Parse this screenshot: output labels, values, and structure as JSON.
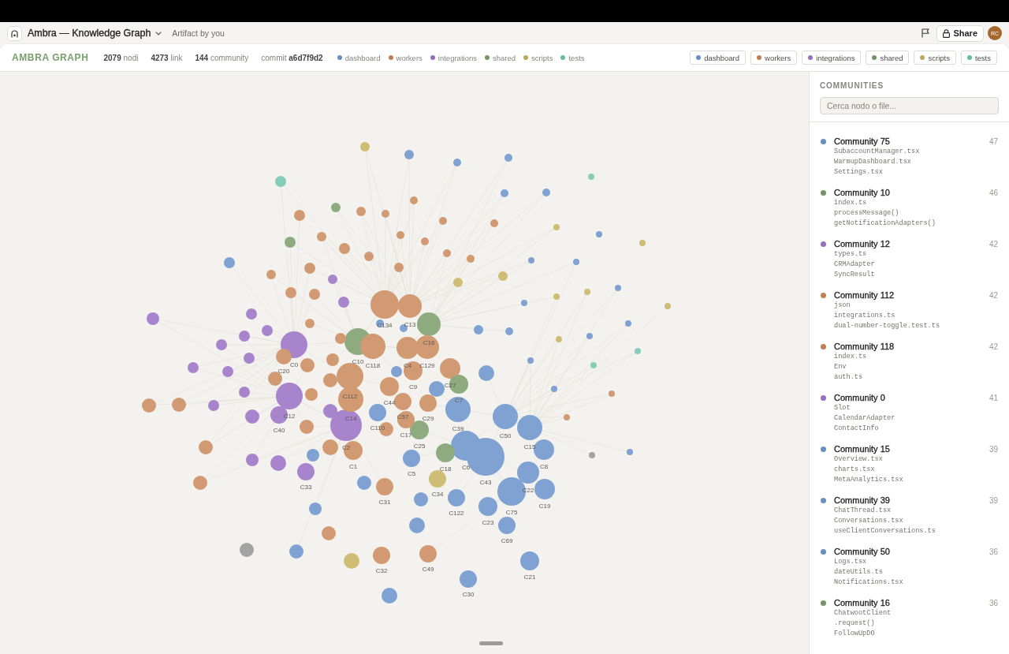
{
  "window": {
    "title": "Ambra — Knowledge Graph",
    "subtitle": "Artifact by you",
    "share_button": "Share",
    "avatar": "RC"
  },
  "toolbar": {
    "brand": "AMBRA GRAPH",
    "stats": [
      "**2079** nodi",
      "**4273** link",
      "**144** community",
      "commit **a6d7f9d2**"
    ],
    "legend": [
      {
        "label": "dashboard",
        "color": "#6a8ec4"
      },
      {
        "label": "workers",
        "color": "#c27f52"
      },
      {
        "label": "integrations",
        "color": "#9670bd"
      },
      {
        "label": "shared",
        "color": "#76946a"
      },
      {
        "label": "scripts",
        "color": "#c0a75a"
      },
      {
        "label": "tests",
        "color": "#6bb9a3"
      }
    ],
    "filters": [
      {
        "label": "dashboard",
        "color": "#6a8ec4"
      },
      {
        "label": "workers",
        "color": "#c27f52"
      },
      {
        "label": "integrations",
        "color": "#9670bd"
      },
      {
        "label": "shared",
        "color": "#76946a"
      },
      {
        "label": "scripts",
        "color": "#c0a75a"
      },
      {
        "label": "tests",
        "color": "#6bb9a3"
      }
    ]
  },
  "graph": {
    "nodes": [
      {
        "color": "#cfbd76"
      },
      {
        "color": "#7fa2d2"
      },
      {
        "color": "#7fa2d2"
      },
      {
        "color": "#7fa2d2"
      },
      {
        "color": "#85ccb9"
      },
      {
        "color": "#85ccb9"
      },
      {
        "color": "#d19a72"
      },
      {
        "color": "#8dab7f"
      },
      {
        "color": "#d19a72"
      },
      {
        "color": "#d19a72"
      },
      {
        "color": "#d19a72"
      },
      {
        "color": "#7fa2d2"
      },
      {
        "color": "#7fa2d2"
      },
      {
        "color": "#d19a72"
      },
      {
        "color": "#d19a72"
      },
      {
        "color": "#cfbd76"
      },
      {
        "color": "#7fa2d2"
      },
      {
        "color": "#cfbd76"
      },
      {
        "color": "#d19a72"
      },
      {
        "color": "#d19a72"
      },
      {
        "color": "#8dab7f"
      },
      {
        "color": "#d19a72"
      },
      {
        "color": "#d19a72"
      },
      {
        "color": "#d19a72"
      },
      {
        "color": "#d19a72"
      },
      {
        "color": "#7fa2d2"
      },
      {
        "color": "#d19a72"
      },
      {
        "color": "#7fa2d2"
      },
      {
        "color": "#7fa2d2"
      },
      {
        "color": "#d19a72"
      },
      {
        "color": "#d19a72"
      },
      {
        "color": "#d19a72"
      },
      {
        "color": "#a884cc"
      },
      {
        "color": "#cfbd76"
      },
      {
        "color": "#cfbd76"
      },
      {
        "color": "#d19a72"
      },
      {
        "color": "#d19a72"
      },
      {
        "color": "#a884cc"
      },
      {
        "color": "#cfbd76"
      },
      {
        "color": "#cfbd76"
      },
      {
        "color": "#7fa2d2"
      },
      {
        "color": "#7fa2d2"
      },
      {
        "color": "#cfbd76"
      },
      {
        "color": "#a884cc"
      },
      {
        "color": "#a884cc"
      },
      {
        "color": "#d19a72"
      },
      {
        "color": "#a884cc"
      },
      {
        "color": "#a884cc"
      },
      {
        "color": "#a884cc"
      },
      {
        "color": "#a884cc"
      },
      {
        "color": "#a884cc"
      },
      {
        "color": "#a884cc"
      },
      {
        "color": "#a884cc"
      },
      {
        "color": "#a884cc"
      },
      {
        "color": "#a884cc"
      },
      {
        "color": "#d19a72"
      },
      {
        "color": "#d19a72"
      },
      {
        "color": "#d19a72"
      },
      {
        "color": "#d19a72"
      },
      {
        "color": "#a884cc"
      },
      {
        "color": "#a884cc"
      },
      {
        "color": "#d19a72"
      },
      {
        "color": "#d19a72"
      },
      {
        "color": "#d19a72"
      },
      {
        "color": "#d19a72"
      },
      {
        "color": "#d19a72"
      },
      {
        "color": "#d19a72"
      },
      {
        "color": "#a884cc"
      },
      {
        "color": "#d19a72"
      },
      {
        "color": "#d19a72"
      },
      {
        "color": "#7fa2d2"
      },
      {
        "color": "#7fa2d2"
      },
      {
        "color": "#7fa2d2"
      },
      {
        "color": "#7fa2d2"
      },
      {
        "color": "#d19a72"
      },
      {
        "color": "#7fa2d2"
      },
      {
        "color": "#7fa2d2"
      },
      {
        "color": "#7fa2d2"
      },
      {
        "color": "#7fa2d2"
      },
      {
        "color": "#7fa2d2"
      },
      {
        "color": "#d19a72"
      },
      {
        "color": "#7fa2d2"
      },
      {
        "color": "#7fa2d2"
      },
      {
        "color": "#7fa2d2"
      },
      {
        "color": "#cfbd76"
      },
      {
        "color": "#7fa2d2"
      },
      {
        "color": "#7fa2d2"
      },
      {
        "color": "#d19a72"
      },
      {
        "color": "#a3a3a3"
      },
      {
        "color": "#7fa2d2"
      },
      {
        "color": "#7fa2d2"
      },
      {
        "color": "#cfbd76"
      },
      {
        "color": "#7fa2d2"
      },
      {
        "color": "#85ccb9"
      },
      {
        "color": "#85ccb9"
      },
      {
        "color": "#7fa2d2"
      },
      {
        "color": "#d19a72"
      },
      {
        "color": "#a3a3a3"
      },
      {
        "color": "#7fa2d2"
      },
      {
        "label": "C134",
        "color": "#d19a72"
      },
      {
        "label": "C13",
        "color": "#d19a72"
      },
      {
        "label": "C16",
        "color": "#8dab7f"
      },
      {
        "label": "C20",
        "color": "#d19a72"
      },
      {
        "label": "C0",
        "color": "#a884cc"
      },
      {
        "label": "C10",
        "color": "#8dab7f"
      },
      {
        "label": "C118",
        "color": "#d19a72"
      },
      {
        "label": "C4",
        "color": "#d19a72"
      },
      {
        "label": "C129",
        "color": "#d19a72"
      },
      {
        "label": "C9",
        "color": "#d19a72"
      },
      {
        "label": "C27",
        "color": "#d19a72"
      },
      {
        "label": "C112",
        "color": "#d19a72"
      },
      {
        "label": "C44",
        "color": "#d19a72"
      },
      {
        "label": "C7",
        "color": "#8dab7f"
      },
      {
        "label": "C12",
        "color": "#a884cc"
      },
      {
        "label": "C14",
        "color": "#d19a72"
      },
      {
        "label": "C57",
        "color": "#d19a72"
      },
      {
        "label": "C29",
        "color": "#d19a72"
      },
      {
        "label": "C40",
        "color": "#a884cc"
      },
      {
        "label": "C110",
        "color": "#7fa2d2"
      },
      {
        "label": "C17",
        "color": "#d19a72"
      },
      {
        "label": "C39",
        "color": "#7fa2d2"
      },
      {
        "label": "C50",
        "color": "#7fa2d2"
      },
      {
        "label": "C2",
        "color": "#a884cc"
      },
      {
        "label": "C25",
        "color": "#8dab7f"
      },
      {
        "label": "C15",
        "color": "#7fa2d2"
      },
      {
        "label": "C1",
        "color": "#d19a72"
      },
      {
        "label": "C5",
        "color": "#7fa2d2"
      },
      {
        "label": "C18",
        "color": "#8dab7f"
      },
      {
        "label": "C6",
        "color": "#7fa2d2"
      },
      {
        "label": "C8",
        "color": "#7fa2d2"
      },
      {
        "label": "C33",
        "color": "#a884cc"
      },
      {
        "label": "C43",
        "color": "#7fa2d2"
      },
      {
        "label": "C34",
        "color": "#cfbd76"
      },
      {
        "label": "C22",
        "color": "#7fa2d2"
      },
      {
        "label": "C31",
        "color": "#d19a72"
      },
      {
        "label": "C122",
        "color": "#7fa2d2"
      },
      {
        "label": "C75",
        "color": "#7fa2d2"
      },
      {
        "label": "C19",
        "color": "#7fa2d2"
      },
      {
        "label": "C23",
        "color": "#7fa2d2"
      },
      {
        "label": "C69",
        "color": "#7fa2d2"
      },
      {
        "label": "C32",
        "color": "#d19a72"
      },
      {
        "label": "C49",
        "color": "#d19a72"
      },
      {
        "label": "C21",
        "color": "#7fa2d2"
      },
      {
        "label": "C30",
        "color": "#7fa2d2"
      }
    ]
  },
  "communities": {
    "title": "COMMUNITIES",
    "search": {
      "placeholder": "Cerca nodo o file..."
    },
    "items": [
      {
        "name": "Community 75",
        "count": "47",
        "color": "#6a8ec4",
        "files": [
          "SubaccountManager.tsx",
          "WarmupDashboard.tsx",
          "Settings.tsx"
        ]
      },
      {
        "name": "Community 10",
        "count": "46",
        "color": "#76946a",
        "files": [
          "index.ts",
          "processMessage()",
          "getNotificationAdapters()"
        ]
      },
      {
        "name": "Community 12",
        "count": "42",
        "color": "#9670bd",
        "files": [
          "types.ts",
          "CRMAdapter",
          "SyncResult"
        ]
      },
      {
        "name": "Community 112",
        "count": "42",
        "color": "#c27f52",
        "files": [
          "json",
          "integrations.ts",
          "dual-number-toggle.test.ts"
        ]
      },
      {
        "name": "Community 118",
        "count": "42",
        "color": "#c27f52",
        "files": [
          "index.ts",
          "Env",
          "auth.ts"
        ]
      },
      {
        "name": "Community 0",
        "count": "41",
        "color": "#9670bd",
        "files": [
          "Slot",
          "CalendarAdapter",
          "ContactInfo"
        ]
      },
      {
        "name": "Community 15",
        "count": "39",
        "color": "#6a8ec4",
        "files": [
          "Overview.tsx",
          "charts.tsx",
          "MetaAnalytics.tsx"
        ]
      },
      {
        "name": "Community 39",
        "count": "39",
        "color": "#6a8ec4",
        "files": [
          "ChatThread.tsx",
          "Conversations.tsx",
          "useClientConversations.ts"
        ]
      },
      {
        "name": "Community 50",
        "count": "36",
        "color": "#6a8ec4",
        "files": [
          "Logs.tsx",
          "dateUtils.ts",
          "Notifications.tsx"
        ]
      },
      {
        "name": "Community 16",
        "count": "36",
        "color": "#76946a",
        "files": [
          "ChatwootClient",
          ".request()",
          "FollowUpDO"
        ]
      }
    ]
  }
}
